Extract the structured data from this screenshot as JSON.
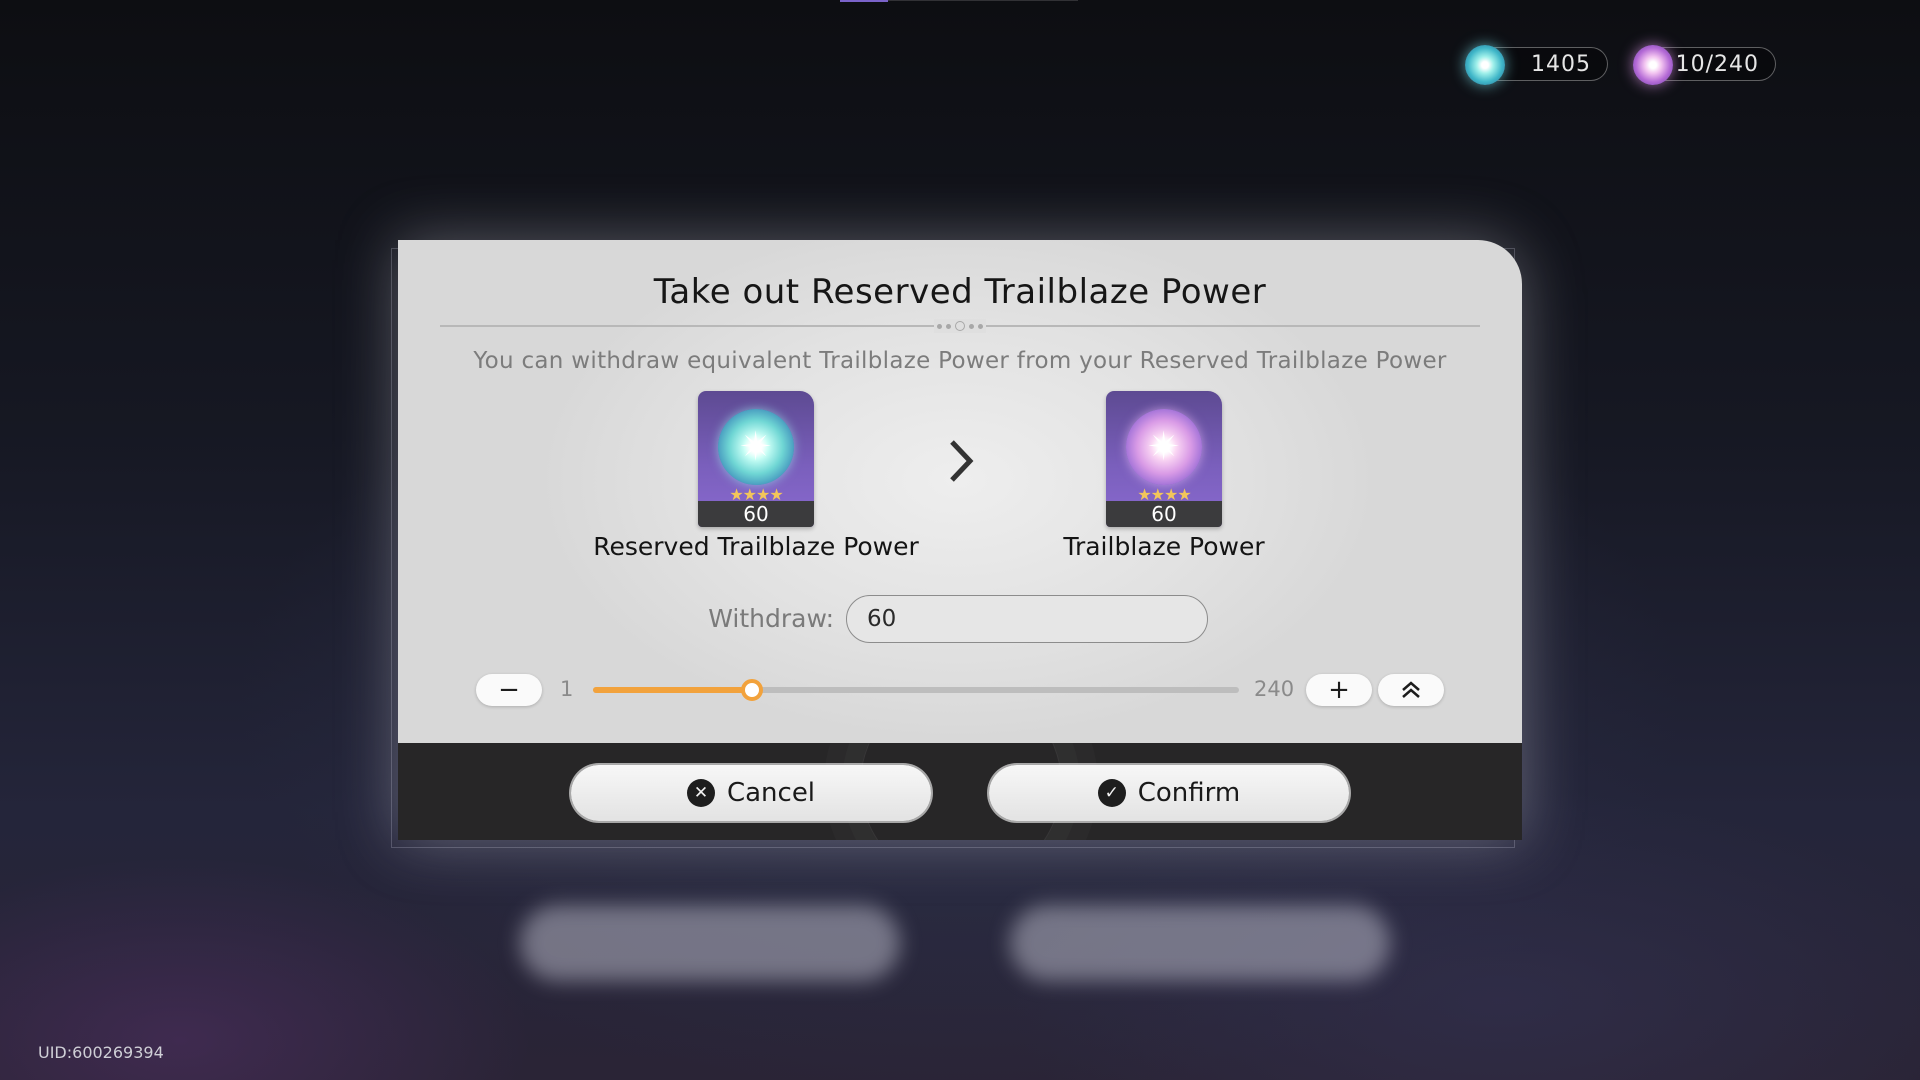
{
  "currencies": {
    "stellar_jade": {
      "value": "1405",
      "icon": "stellar-jade-icon"
    },
    "trailblaze_power": {
      "value": "10/240",
      "icon": "trailblaze-power-icon"
    }
  },
  "uid": "UID:600269394",
  "dialog": {
    "title": "Take out Reserved Trailblaze Power",
    "subtitle": "You can withdraw equivalent Trailblaze Power from your Reserved Trailblaze Power",
    "source_item": {
      "label": "Reserved Trailblaze Power",
      "quantity": "60",
      "stars": "★★★★",
      "icon": "reserved-trailblaze-power-icon"
    },
    "target_item": {
      "label": "Trailblaze Power",
      "quantity": "60",
      "stars": "★★★★",
      "icon": "trailblaze-power-icon"
    },
    "withdraw": {
      "label": "Withdraw:",
      "value": "60"
    },
    "slider": {
      "min_label": "1",
      "max_label": "240",
      "min": 1,
      "max": 240,
      "value": 60
    },
    "buttons": {
      "decrease": "−",
      "increase": "+",
      "max": "⌃⌃",
      "cancel": "Cancel",
      "confirm": "Confirm"
    }
  },
  "colors": {
    "accent_orange": "#f2a23c",
    "card_purple": "#7a5fbc",
    "footer_dark": "#272627"
  }
}
